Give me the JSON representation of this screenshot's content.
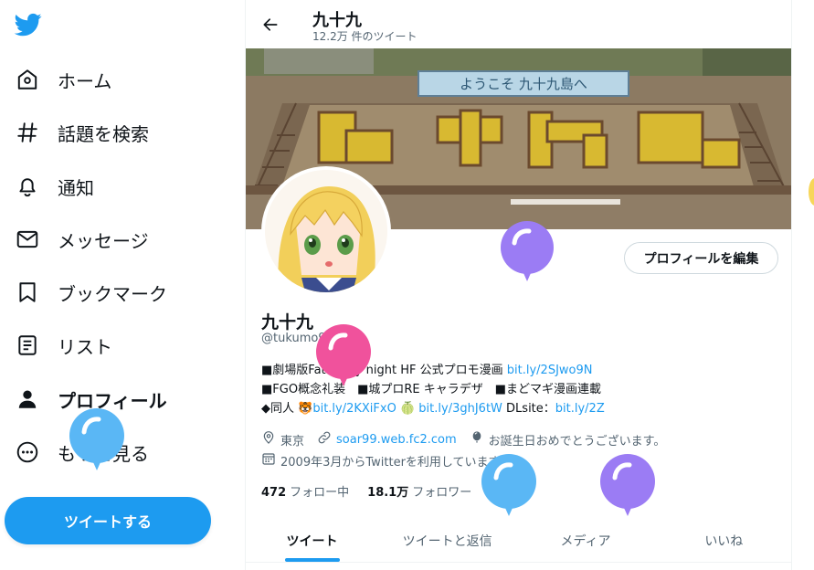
{
  "nav": {
    "items": [
      {
        "label": "ホーム",
        "icon": "home-icon"
      },
      {
        "label": "話題を検索",
        "icon": "hashtag-icon"
      },
      {
        "label": "通知",
        "icon": "bell-icon"
      },
      {
        "label": "メッセージ",
        "icon": "mail-icon"
      },
      {
        "label": "ブックマーク",
        "icon": "bookmark-icon"
      },
      {
        "label": "リスト",
        "icon": "list-icon"
      },
      {
        "label": "プロフィール",
        "icon": "person-icon"
      },
      {
        "label": "もっと見る",
        "icon": "more-icon"
      }
    ],
    "active_index": 6,
    "tweet_button": "ツイートする"
  },
  "header": {
    "name": "九十九",
    "tweet_count": "12.2万 件のツイート"
  },
  "banner": {
    "sign_text": "ようこそ 九十九島へ"
  },
  "profile": {
    "edit_button": "プロフィールを編集",
    "display_name": "九十九",
    "handle": "@tukumo99",
    "bio": {
      "line1_text": "■劇場版Fate/stay night HF 公式プロモ漫画 ",
      "line1_link": "bit.ly/2SJwo9N",
      "line2_text": "■FGO概念礼装　■城プロRE キャラデザ　■まどマギ漫画連載",
      "line3_prefix": "◆同人 ",
      "line3_emoji1": "🐯",
      "line3_link1": "bit.ly/2KXiFxO",
      "line3_emoji2": "🍈",
      "line3_link2": "bit.ly/3ghJ6tW",
      "line3_dl": " DLsite：",
      "line3_link3": "bit.ly/2Z"
    },
    "location": "東京",
    "website": "soar99.web.fc2.com",
    "birthday": "お誕生日おめでとうございます。",
    "joined": "2009年3月からTwitterを利用しています",
    "following_count": "472",
    "following_label": "フォロー中",
    "followers_count": "18.1万",
    "followers_label": "フォロワー"
  },
  "tabs": [
    "ツイート",
    "ツイートと返信",
    "メディア",
    "いいね"
  ],
  "colors": {
    "accent": "#1d9bf0",
    "balloon_purple": "#9b7cf4",
    "balloon_pink": "#f0529c",
    "balloon_blue": "#5ab7f5"
  }
}
